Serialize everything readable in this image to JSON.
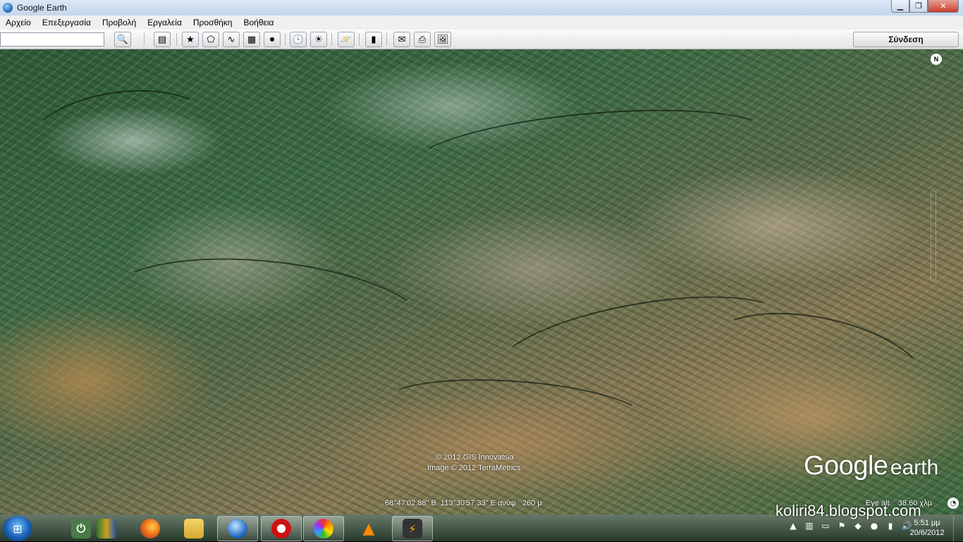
{
  "window": {
    "title": "Google Earth"
  },
  "menu": [
    "Αρχείο",
    "Επεξεργασία",
    "Προβολή",
    "Εργαλεία",
    "Προσθήκη",
    "Βοήθεια"
  ],
  "toolbar": {
    "search_value": "",
    "signin_label": "Σύνδεση",
    "buttons": [
      "search-icon",
      "sidebar-icon",
      "placemark-icon",
      "polygon-icon",
      "path-icon",
      "overlay-icon",
      "record-tour-icon",
      "historical-imagery-icon",
      "sunlight-icon",
      "planets-icon",
      "ruler-icon",
      "email-icon",
      "print-icon",
      "save-image-icon"
    ]
  },
  "map": {
    "north_label": "N",
    "attribution": [
      "© 2012 GIS Innovatsia",
      "Image © 2012 TerraMetrics"
    ],
    "logo": {
      "google": "Google",
      "earth": "earth"
    },
    "status": "68°47'02.88\" Β  113°30'57.33\" Ε ανύψ   260 μ",
    "eye_alt": "Eye alt    38.60 χλμ"
  },
  "taskbar": {
    "apps": [
      "power-plug-icon",
      "books-icon",
      "firefox-icon",
      "explorer-folder-icon",
      "google-earth-icon",
      "opera-icon",
      "picasa-icon",
      "vlc-icon",
      "winamp-icon"
    ],
    "active_app": "google-earth-icon",
    "clock": {
      "time": "5:51 μμ",
      "date": "20/6/2012"
    }
  },
  "watermark": "koliri84.blogspot.com",
  "colors": {
    "titlebar": "#c3d6ec",
    "close": "#c6402b",
    "taskbar": "#2c3f30"
  }
}
